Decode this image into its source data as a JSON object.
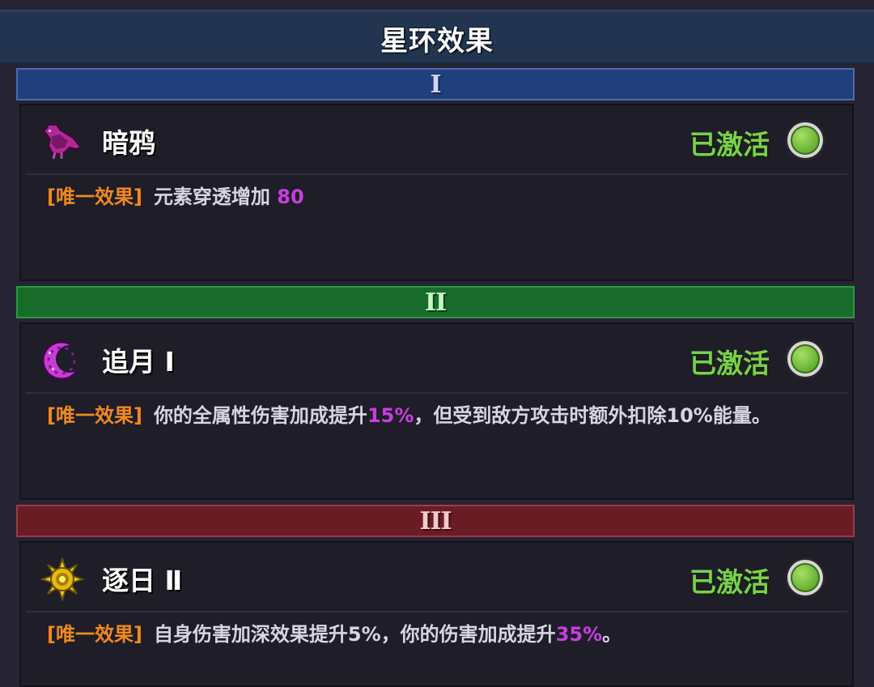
{
  "title": "星环效果",
  "tiers": [
    {
      "numeral": "I",
      "name": "暗鸦",
      "icon": "crow-icon",
      "status": "已激活",
      "desc": {
        "tag": "[唯一效果]",
        "part1": "元素穿透增加",
        "value1": " 80",
        "part2": "",
        "value2": "",
        "part3": ""
      }
    },
    {
      "numeral": "II",
      "name": "追月 Ⅰ",
      "icon": "crescent-moon-icon",
      "status": "已激活",
      "desc": {
        "tag": "[唯一效果]",
        "part1": "你的全属性伤害加成提升",
        "value1": "15%",
        "part2": "，但受到敌方攻击时额外扣除10%能量。",
        "value2": "",
        "part3": ""
      }
    },
    {
      "numeral": "III",
      "name": "逐日 Ⅱ",
      "icon": "sun-icon",
      "status": "已激活",
      "desc": {
        "tag": "[唯一效果]",
        "part1": "自身伤害加深效果提升5%，你的伤害加成提升",
        "value1": "35%",
        "part2": "。",
        "value2": "",
        "part3": ""
      }
    }
  ],
  "colors": {
    "active_status": "#7ccf4b",
    "tag": "#f08a1c",
    "highlight": "#c83ee0"
  }
}
